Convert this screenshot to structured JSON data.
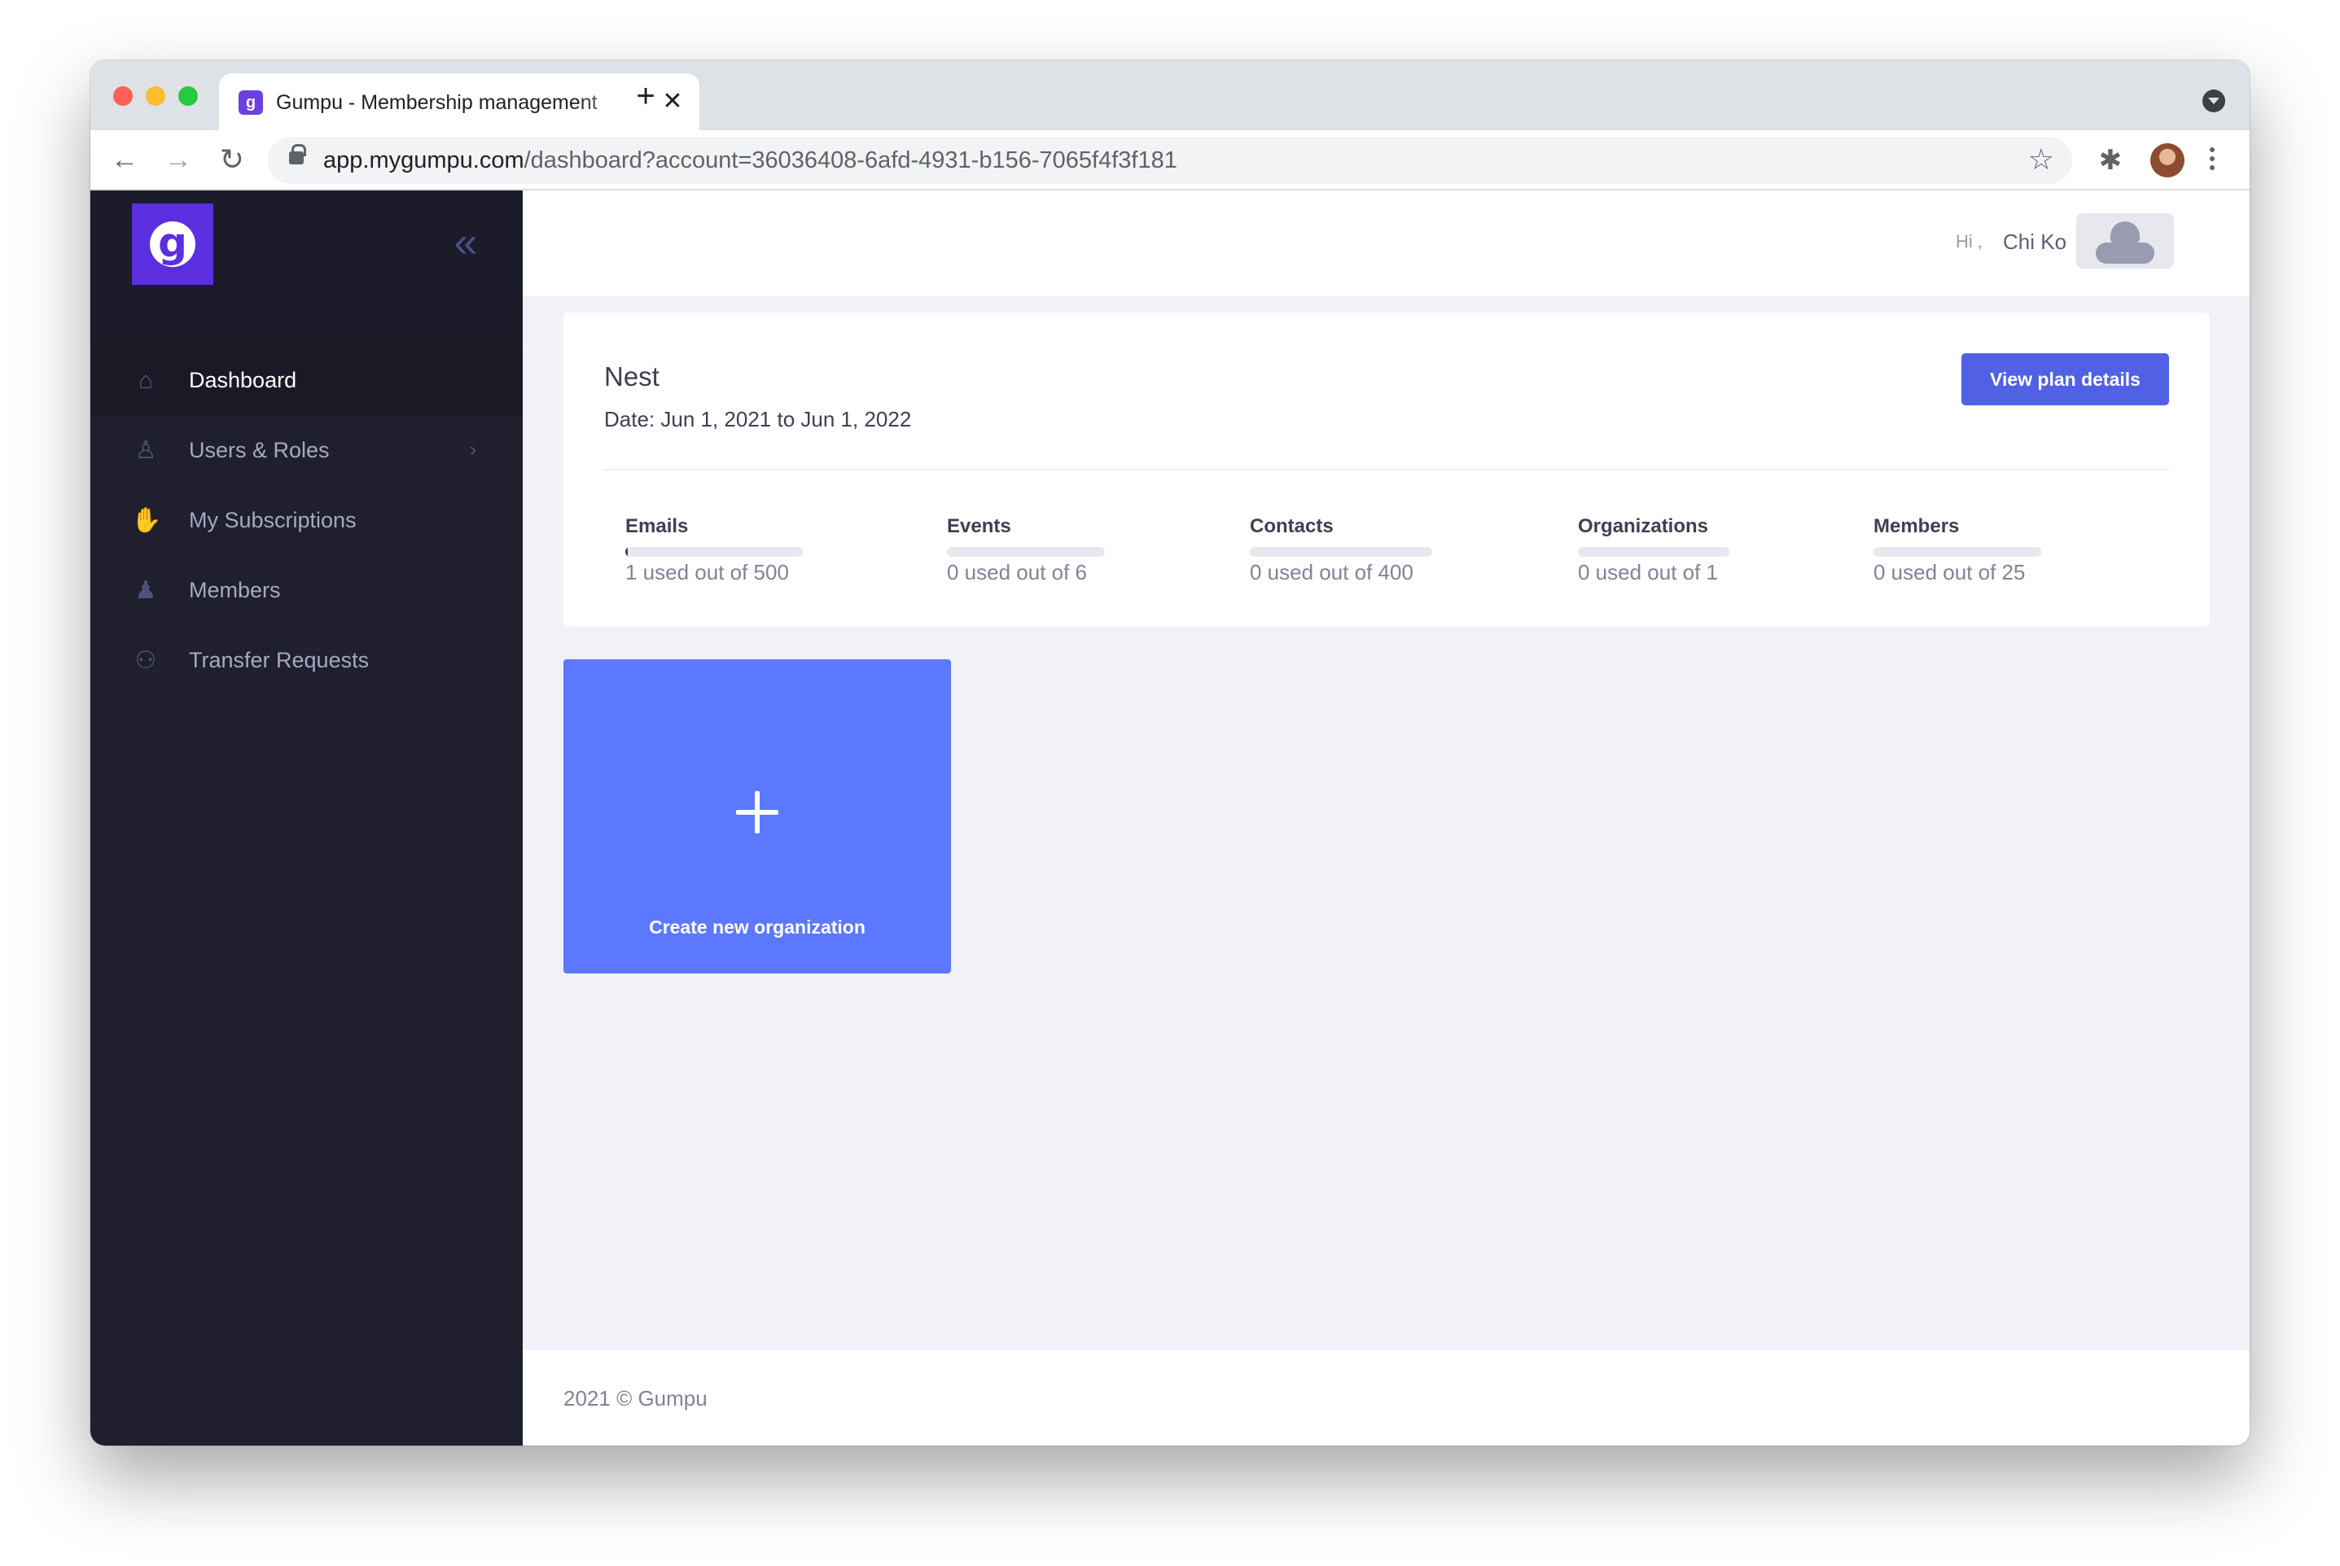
{
  "browser": {
    "tab_title": "Gumpu - Membership management",
    "tab_favicon": "g",
    "tab_close": "✕",
    "new_tab": "+",
    "url_host": "app.mygumpu.com",
    "url_path": "/dashboard?account=36036408-6afd-4931-b156-7065f4f3f181",
    "icons": {
      "back": "back-arrow-icon",
      "forward": "forward-arrow-icon",
      "reload": "reload-icon",
      "lock": "lock-icon",
      "bookmark": "star-icon",
      "extensions": "puzzle-icon",
      "menu": "kebab-menu-icon"
    }
  },
  "sidebar": {
    "logo_letter": "g",
    "collapse_glyph": "«",
    "items": [
      {
        "label": "Dashboard",
        "icon": "home-icon",
        "active": true
      },
      {
        "label": "Users & Roles",
        "icon": "user-icon",
        "has_submenu": true
      },
      {
        "label": "My Subscriptions",
        "icon": "subscriptions-icon"
      },
      {
        "label": "Members",
        "icon": "members-icon"
      },
      {
        "label": "Transfer Requests",
        "icon": "transfer-icon"
      }
    ]
  },
  "header": {
    "greeting": "Hi ,",
    "user_name": "Chi Ko"
  },
  "plan": {
    "name": "Nest",
    "date": "Date: Jun 1, 2021 to Jun 1, 2022",
    "button_label": "View plan details",
    "stats": [
      {
        "label": "Emails",
        "value_text": "1 used out of 500",
        "used": 1,
        "total": 500
      },
      {
        "label": "Events",
        "value_text": "0 used out of 6",
        "used": 0,
        "total": 6
      },
      {
        "label": "Contacts",
        "value_text": "0 used out of 400",
        "used": 0,
        "total": 400
      },
      {
        "label": "Organizations",
        "value_text": "0 used out of 1",
        "used": 0,
        "total": 1
      },
      {
        "label": "Members",
        "value_text": "0 used out of 25",
        "used": 0,
        "total": 25
      }
    ]
  },
  "create_org": {
    "label": "Create new organization",
    "icon": "plus-icon"
  },
  "footer": {
    "text": "2021 © Gumpu"
  },
  "colors": {
    "sidebar_bg": "#1f1f2e",
    "primary_button": "#5161e6",
    "tile": "#5b78fe",
    "logo": "#5b2ee0"
  }
}
